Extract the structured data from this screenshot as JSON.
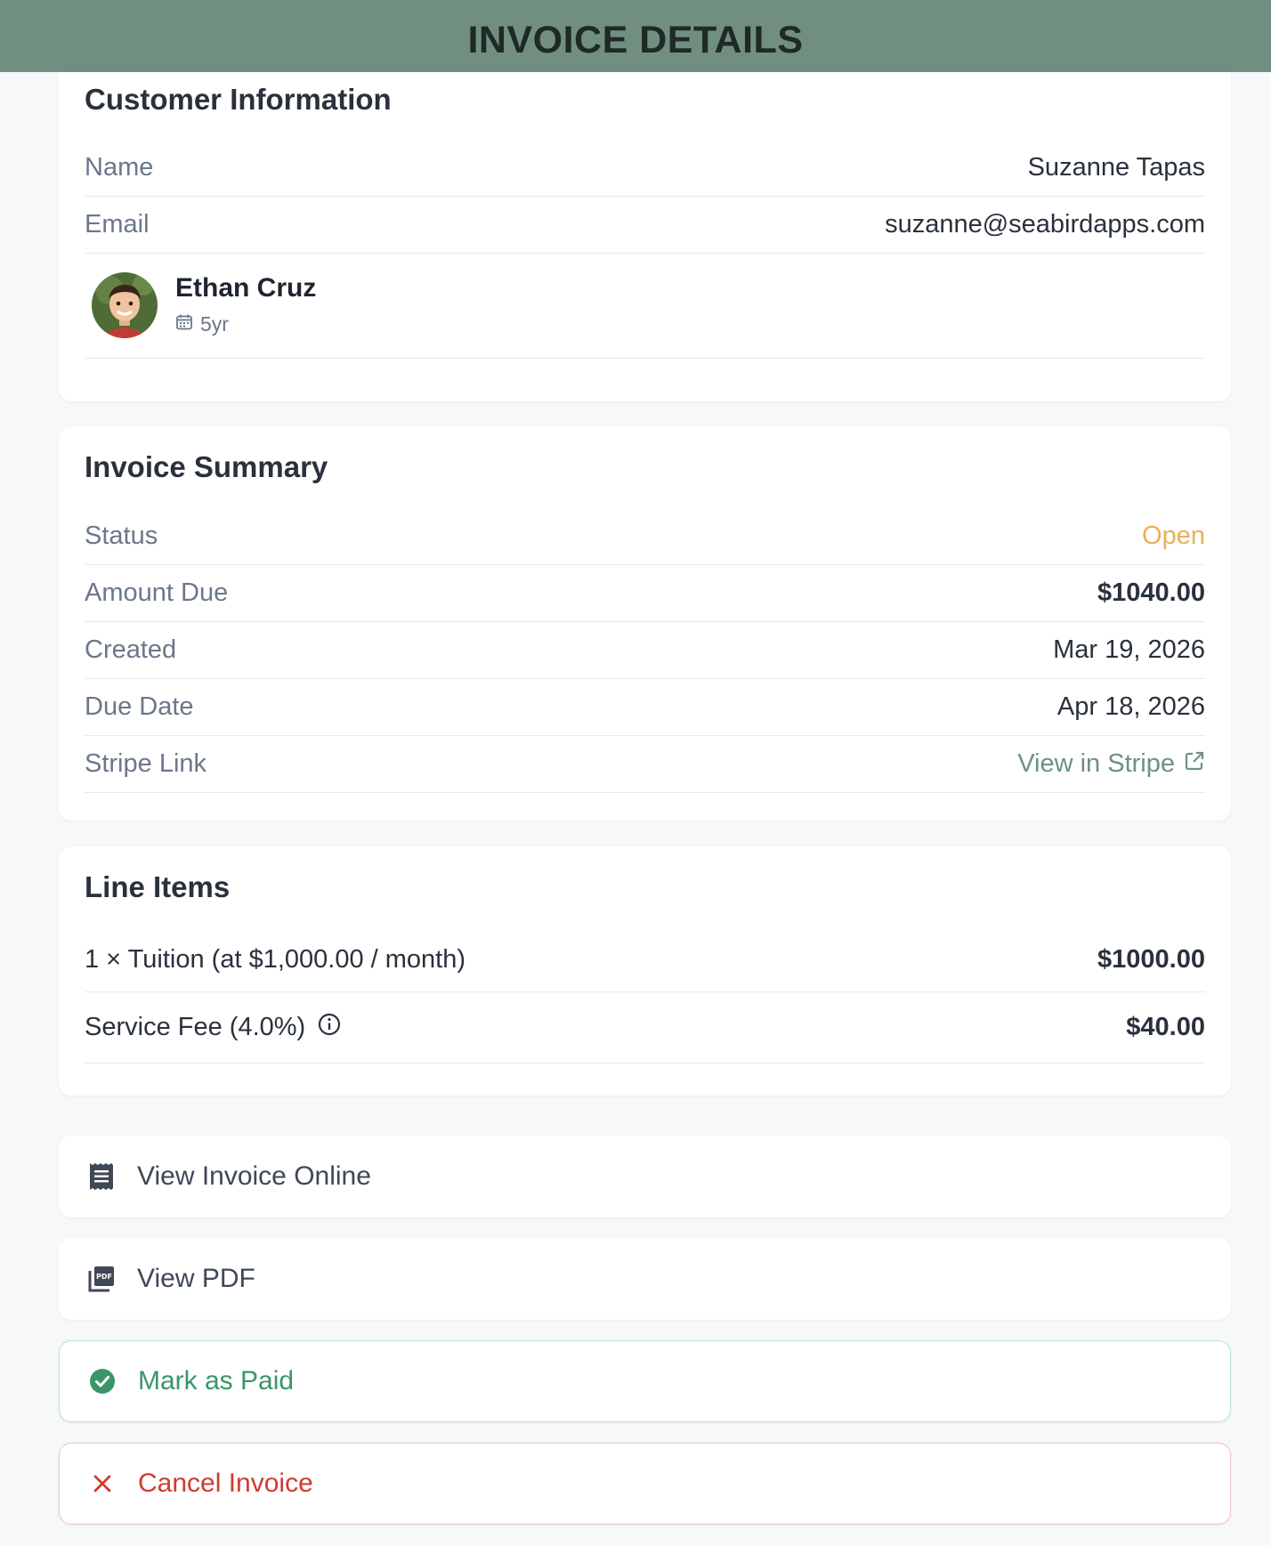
{
  "header": {
    "title": "INVOICE DETAILS"
  },
  "customer": {
    "section_title": "Customer Information",
    "name_label": "Name",
    "name_value": "Suzanne Tapas",
    "email_label": "Email",
    "email_value": "suzanne@seabirdapps.com",
    "child": {
      "name": "Ethan Cruz",
      "age": "5yr"
    }
  },
  "summary": {
    "section_title": "Invoice Summary",
    "status_label": "Status",
    "status_value": "Open",
    "amount_label": "Amount Due",
    "amount_value": "$1040.00",
    "created_label": "Created",
    "created_value": "Mar 19, 2026",
    "due_label": "Due Date",
    "due_value": "Apr 18, 2026",
    "stripe_label": "Stripe Link",
    "stripe_value": "View in Stripe"
  },
  "line_items": {
    "section_title": "Line Items",
    "items": [
      {
        "description": "1 × Tuition (at $1,000.00 / month)",
        "amount": "$1000.00"
      },
      {
        "description": "Service Fee (4.0%)",
        "amount": "$40.00"
      }
    ]
  },
  "actions": {
    "view_online": "View Invoice Online",
    "view_pdf": "View PDF",
    "mark_paid": "Mark as Paid",
    "cancel": "Cancel Invoice"
  },
  "colors": {
    "header_bg": "#718f80",
    "status_open": "#ecae57",
    "link": "#6e9180",
    "success": "#3a9668",
    "danger": "#cf3b31"
  }
}
